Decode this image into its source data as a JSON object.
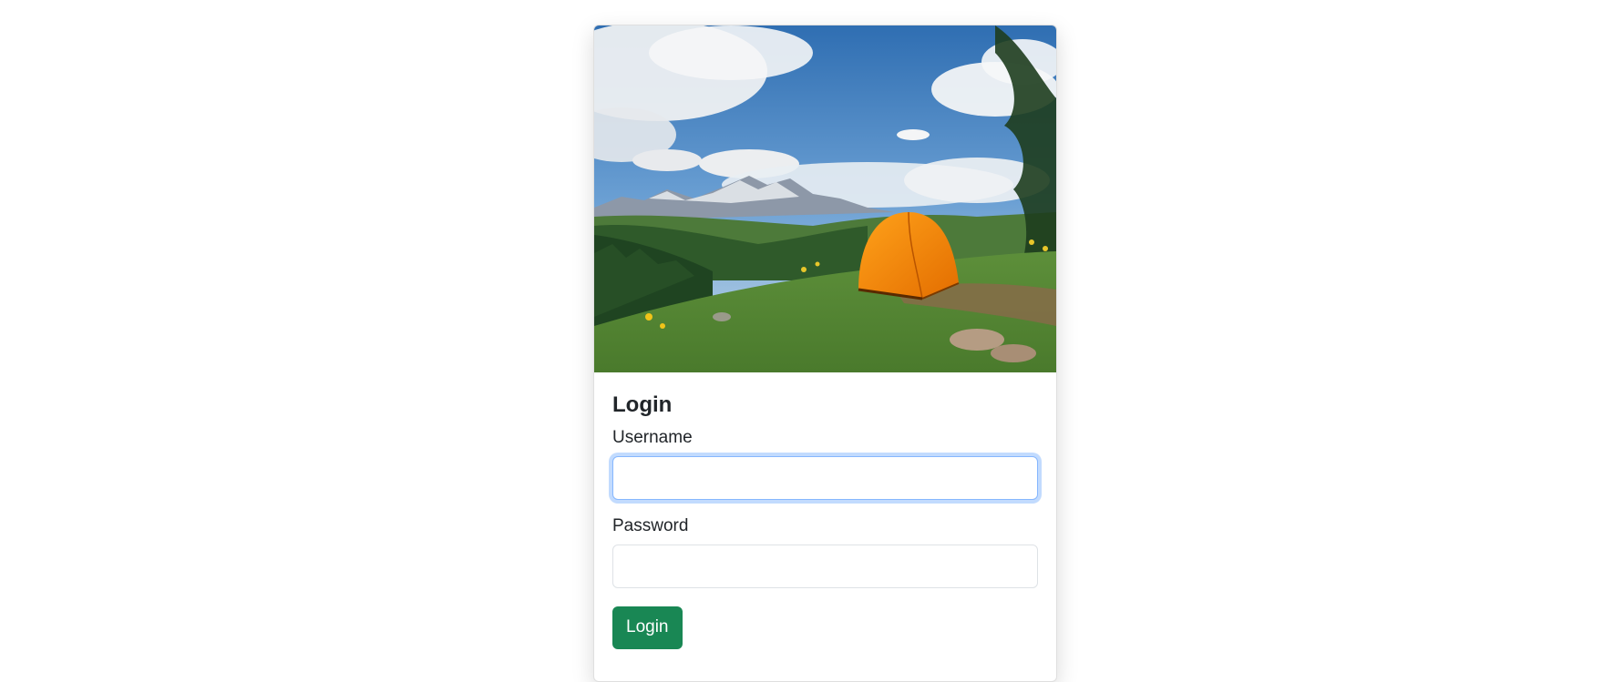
{
  "login_form": {
    "title": "Login",
    "username_label": "Username",
    "username_value": "",
    "password_label": "Password",
    "password_value": "",
    "submit_label": "Login"
  },
  "hero_image": {
    "subject": "orange tent on grassy hillside with mountains and cloudy sky"
  },
  "colors": {
    "primary_button": "#198754",
    "focus_border": "#86b7fe"
  }
}
